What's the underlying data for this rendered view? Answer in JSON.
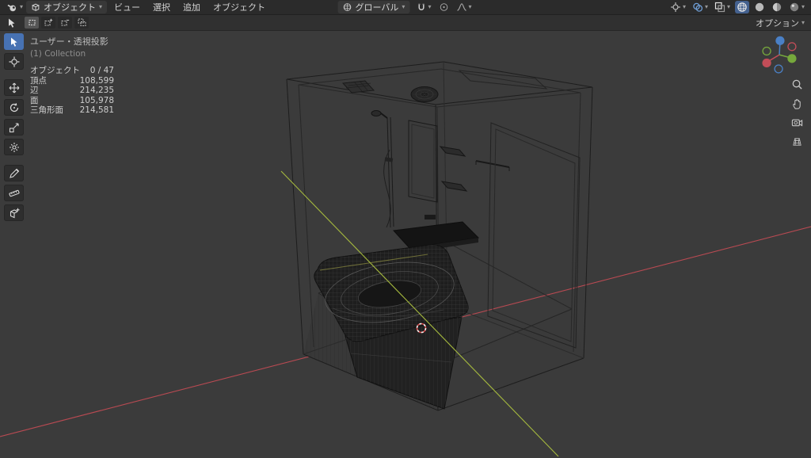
{
  "topbar": {
    "mode_label": "オブジェクト",
    "menus": [
      {
        "label": "ビュー"
      },
      {
        "label": "選択"
      },
      {
        "label": "追加"
      },
      {
        "label": "オブジェクト"
      }
    ],
    "orientation_label": "グローバル"
  },
  "toolsettings": {
    "options_label": "オプション"
  },
  "viewport": {
    "view_label": "ユーザー・透視投影",
    "collection_label": "(1) Collection",
    "stats": [
      {
        "label": "オブジェクト",
        "value": "0 / 47"
      },
      {
        "label": "頂点",
        "value": "108,599"
      },
      {
        "label": "辺",
        "value": "214,235"
      },
      {
        "label": "面",
        "value": "105,978"
      },
      {
        "label": "三角形面",
        "value": "214,581"
      }
    ]
  },
  "colors": {
    "axis_x": "#b84a52",
    "axis_y": "#a5b93e",
    "gizmo_x": "#c24d58",
    "gizmo_y": "#76a83c",
    "gizmo_z": "#4a80c6",
    "active_tool": "#4772b3"
  }
}
